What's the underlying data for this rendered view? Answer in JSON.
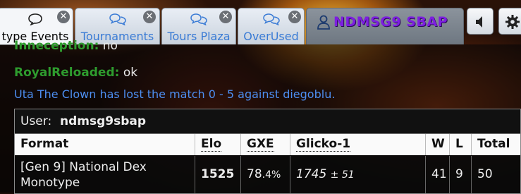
{
  "tabs": [
    {
      "label": "type Events",
      "icon": "chat-bubble-icon",
      "active": true
    },
    {
      "label": "Tournaments",
      "icon": "chat-bubbles-icon",
      "active": false
    },
    {
      "label": "Tours Plaza",
      "icon": "chat-bubbles-icon",
      "active": false
    },
    {
      "label": "OverUsed",
      "icon": "chat-bubbles-icon",
      "active": false
    }
  ],
  "user_tab": {
    "name": "NDMSG9 SBAP",
    "icon": "user-icon"
  },
  "toolbar": {
    "sound_icon": "speaker-icon",
    "settings_icon": "gear-icon"
  },
  "chat": {
    "partial_line": {
      "user": "Inneception:",
      "message": "no"
    },
    "line2": {
      "user": "RoyalReloaded:",
      "message": "ok"
    },
    "notice": "Uta The Clown has lost the match 0 - 5 against diegoblu."
  },
  "ladder": {
    "user_label": "User:",
    "user_name": "ndmsg9sbap",
    "headers": {
      "format": "Format",
      "elo": "Elo",
      "gxe": "GXE",
      "glicko": "Glicko-1",
      "w": "W",
      "l": "L",
      "total": "Total"
    },
    "row": {
      "format_line1": "[Gen 9] National Dex",
      "format_line2": "Monotype",
      "elo": "1525",
      "gxe_main": "78",
      "gxe_dec": ".4%",
      "glicko": "1745",
      "glicko_dev": "± 51",
      "w": "41",
      "l": "9",
      "total": "50"
    }
  },
  "colors": {
    "accent": "#3a7bd5",
    "username": "#7d1fe0",
    "chat_user": "#2e9c2e",
    "notice": "#4d8ef0"
  }
}
